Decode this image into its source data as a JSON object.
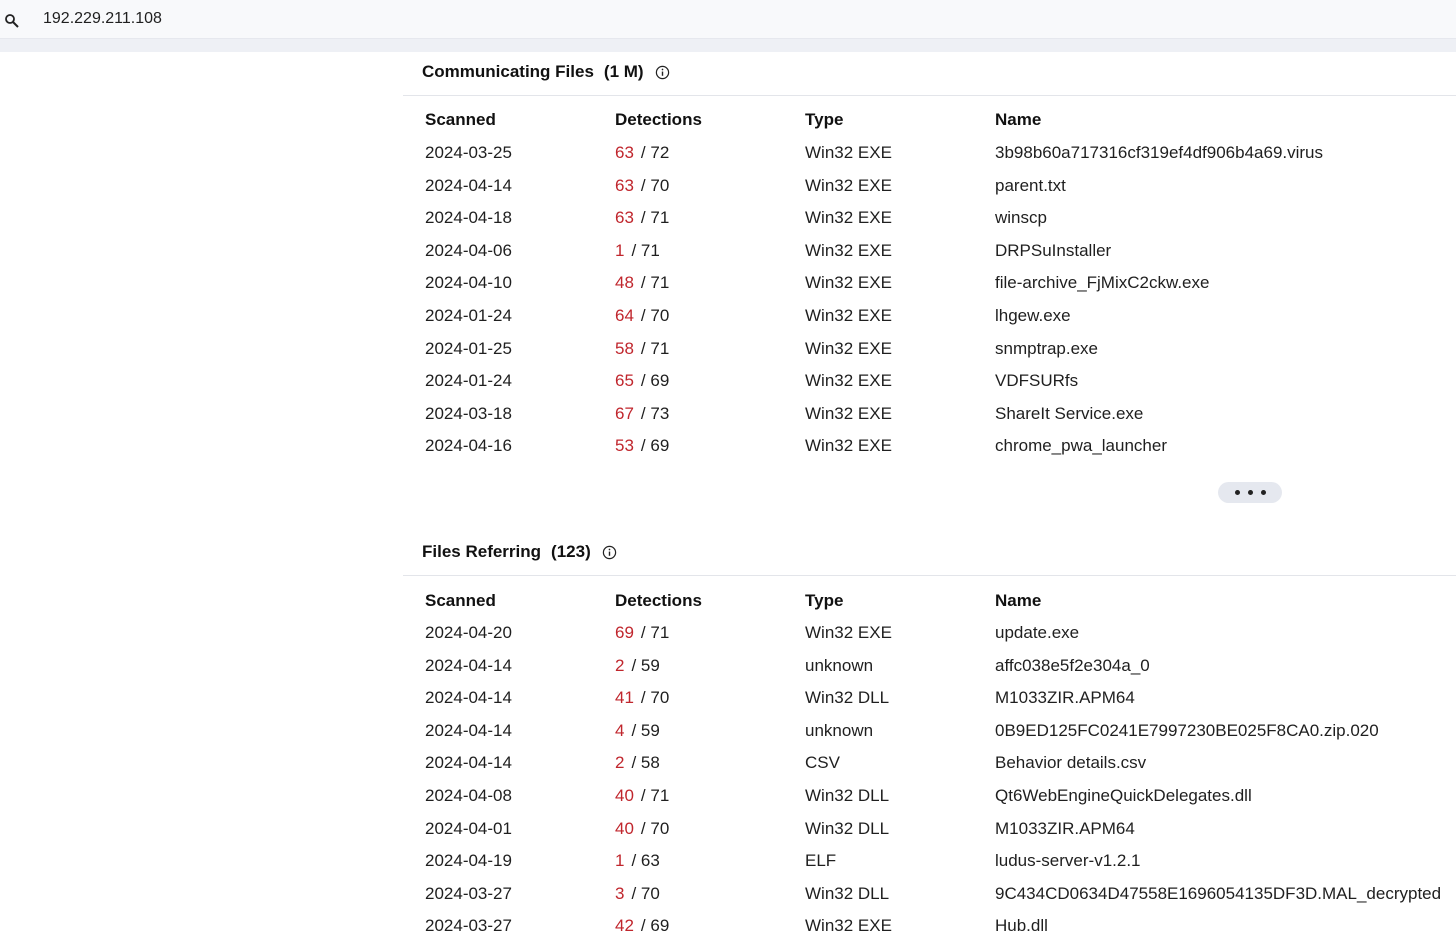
{
  "search": {
    "value": "192.229.211.108"
  },
  "columns": {
    "scanned": "Scanned",
    "detections": "Detections",
    "type": "Type",
    "name": "Name"
  },
  "communicating_files": {
    "title": "Communicating Files",
    "count": "(1 M)",
    "rows": [
      {
        "scanned": "2024-03-25",
        "positives": "63",
        "total": "/ 72",
        "type": "Win32 EXE",
        "name": "3b98b60a717316cf319ef4df906b4a69.virus"
      },
      {
        "scanned": "2024-04-14",
        "positives": "63",
        "total": "/ 70",
        "type": "Win32 EXE",
        "name": "parent.txt"
      },
      {
        "scanned": "2024-04-18",
        "positives": "63",
        "total": "/ 71",
        "type": "Win32 EXE",
        "name": "winscp"
      },
      {
        "scanned": "2024-04-06",
        "positives": "1",
        "total": "/ 71",
        "type": "Win32 EXE",
        "name": "DRPSuInstaller"
      },
      {
        "scanned": "2024-04-10",
        "positives": "48",
        "total": "/ 71",
        "type": "Win32 EXE",
        "name": "file-archive_FjMixC2ckw.exe"
      },
      {
        "scanned": "2024-01-24",
        "positives": "64",
        "total": "/ 70",
        "type": "Win32 EXE",
        "name": "lhgew.exe"
      },
      {
        "scanned": "2024-01-25",
        "positives": "58",
        "total": "/ 71",
        "type": "Win32 EXE",
        "name": "snmptrap.exe"
      },
      {
        "scanned": "2024-01-24",
        "positives": "65",
        "total": "/ 69",
        "type": "Win32 EXE",
        "name": "VDFSURfs"
      },
      {
        "scanned": "2024-03-18",
        "positives": "67",
        "total": "/ 73",
        "type": "Win32 EXE",
        "name": "ShareIt Service.exe"
      },
      {
        "scanned": "2024-04-16",
        "positives": "53",
        "total": "/ 69",
        "type": "Win32 EXE",
        "name": "chrome_pwa_launcher"
      }
    ]
  },
  "files_referring": {
    "title": "Files Referring",
    "count": "(123)",
    "rows": [
      {
        "scanned": "2024-04-20",
        "positives": "69",
        "total": "/ 71",
        "type": "Win32 EXE",
        "name": "update.exe"
      },
      {
        "scanned": "2024-04-14",
        "positives": "2",
        "total": "/ 59",
        "type": "unknown",
        "name": "affc038e5f2e304a_0"
      },
      {
        "scanned": "2024-04-14",
        "positives": "41",
        "total": "/ 70",
        "type": "Win32 DLL",
        "name": "M1033ZIR.APM64"
      },
      {
        "scanned": "2024-04-14",
        "positives": "4",
        "total": "/ 59",
        "type": "unknown",
        "name": "0B9ED125FC0241E7997230BE025F8CA0.zip.020"
      },
      {
        "scanned": "2024-04-14",
        "positives": "2",
        "total": "/ 58",
        "type": "CSV",
        "name": "Behavior details.csv"
      },
      {
        "scanned": "2024-04-08",
        "positives": "40",
        "total": "/ 71",
        "type": "Win32 DLL",
        "name": "Qt6WebEngineQuickDelegates.dll"
      },
      {
        "scanned": "2024-04-01",
        "positives": "40",
        "total": "/ 70",
        "type": "Win32 DLL",
        "name": "M1033ZIR.APM64"
      },
      {
        "scanned": "2024-04-19",
        "positives": "1",
        "total": "/ 63",
        "type": "ELF",
        "name": "ludus-server-v1.2.1"
      },
      {
        "scanned": "2024-03-27",
        "positives": "3",
        "total": "/ 70",
        "type": "Win32 DLL",
        "name": "9C434CD0634D47558E1696054135DF3D.MAL_decrypted"
      },
      {
        "scanned": "2024-03-27",
        "positives": "42",
        "total": "/ 69",
        "type": "Win32 EXE",
        "name": "Hub.dll"
      }
    ]
  },
  "colors": {
    "detection_positive": "#c0262d"
  },
  "icons": {
    "search": "search-icon",
    "info": "info-icon",
    "more": "more-dots-icon"
  }
}
